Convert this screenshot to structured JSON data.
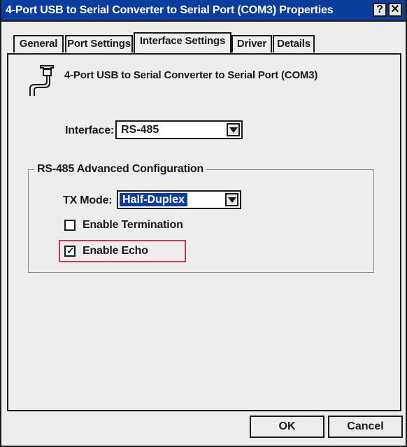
{
  "window": {
    "title": "4-Port USB to Serial Converter to Serial Port (COM3) Properties",
    "help_label": "?",
    "close_label": "✕"
  },
  "tabs": [
    {
      "label": "General"
    },
    {
      "label": "Port Settings"
    },
    {
      "label": "Interface Settings",
      "active": true
    },
    {
      "label": "Driver"
    },
    {
      "label": "Details"
    }
  ],
  "device": {
    "name": "4-Port USB to Serial Converter to Serial Port (COM3)",
    "icon": "serial-port-icon"
  },
  "interface": {
    "label": "Interface:",
    "value": "RS-485"
  },
  "advanced": {
    "title": "RS-485 Advanced Configuration",
    "tx_mode_label": "TX Mode:",
    "tx_mode_value": "Half-Duplex",
    "enable_termination_label": "Enable Termination",
    "enable_termination_checked": false,
    "enable_echo_label": "Enable Echo",
    "enable_echo_checked": true,
    "highlight_color": "#c23a4e"
  },
  "buttons": {
    "ok_label": "OK",
    "cancel_label": "Cancel"
  },
  "colors": {
    "titlebar": "#0b3e9c",
    "dialog_bg": "#ededed"
  }
}
